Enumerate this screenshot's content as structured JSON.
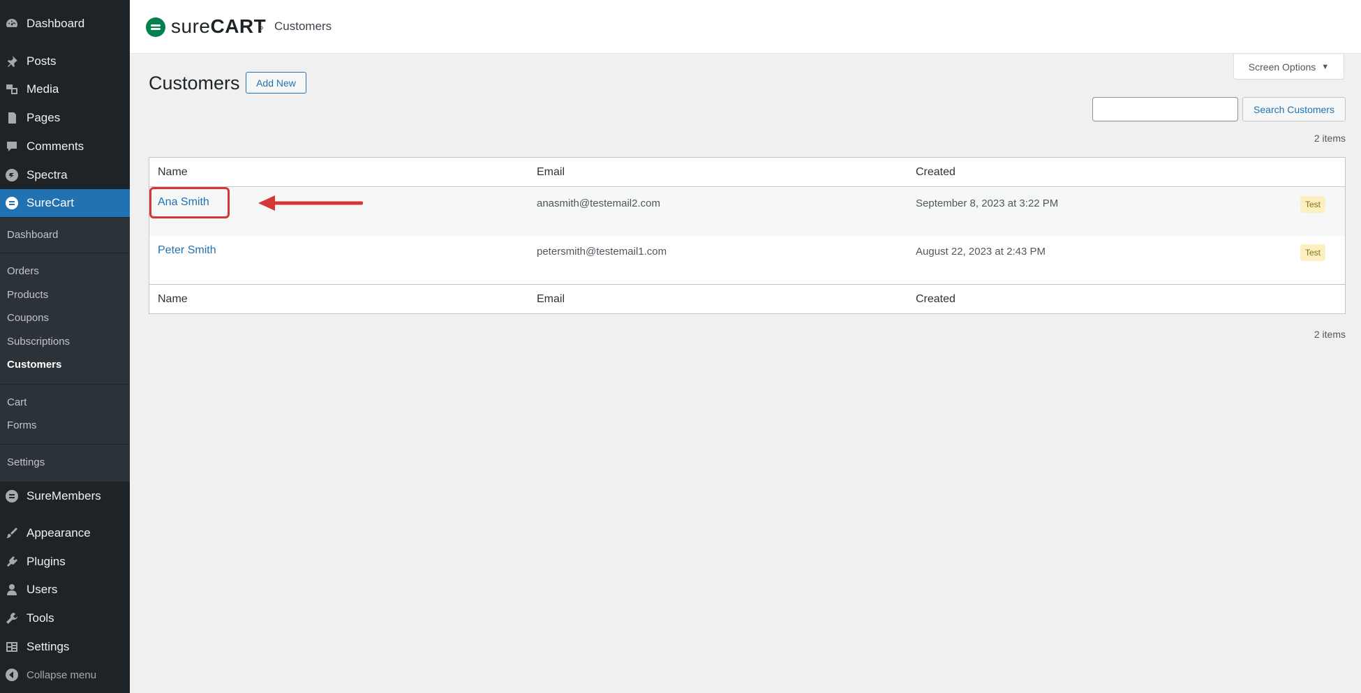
{
  "sidebar": {
    "top_items": [
      {
        "label": "Dashboard",
        "icon": "dashboard-icon"
      },
      {
        "label": "Posts",
        "icon": "pin-icon"
      },
      {
        "label": "Media",
        "icon": "media-icon"
      },
      {
        "label": "Pages",
        "icon": "pages-icon"
      },
      {
        "label": "Comments",
        "icon": "comment-icon"
      },
      {
        "label": "Spectra",
        "icon": "spectra-icon"
      },
      {
        "label": "SureCart",
        "icon": "surecart-icon"
      }
    ],
    "surecart_submenu": {
      "dashboard": "Dashboard",
      "orders": "Orders",
      "products": "Products",
      "coupons": "Coupons",
      "subscriptions": "Subscriptions",
      "customers": "Customers",
      "cart": "Cart",
      "forms": "Forms",
      "settings": "Settings"
    },
    "bottom_items": [
      {
        "label": "SureMembers",
        "icon": "suremembers-icon"
      },
      {
        "label": "Appearance",
        "icon": "brush-icon"
      },
      {
        "label": "Plugins",
        "icon": "plugin-icon"
      },
      {
        "label": "Users",
        "icon": "users-icon"
      },
      {
        "label": "Tools",
        "icon": "wrench-icon"
      },
      {
        "label": "Settings",
        "icon": "settings-icon"
      },
      {
        "label": "Collapse menu",
        "icon": "collapse-icon"
      }
    ]
  },
  "header": {
    "logo_sure": "sure",
    "logo_cart": "CART",
    "breadcrumb_separator": "›",
    "breadcrumb_current": "Customers"
  },
  "screen_options": {
    "label": "Screen Options",
    "arrow": "▼"
  },
  "page": {
    "title": "Customers",
    "add_new_label": "Add New",
    "search_placeholder": "",
    "search_button_label": "Search Customers",
    "items_count_top": "2 items",
    "items_count_bottom": "2 items"
  },
  "table": {
    "columns": [
      "Name",
      "Email",
      "Created"
    ],
    "rows": [
      {
        "name": "Ana Smith",
        "email": "anasmith@testemail2.com",
        "created": "September 8, 2023 at 3:22 PM",
        "badge": "Test"
      },
      {
        "name": "Peter Smith",
        "email": "petersmith@testemail1.com",
        "created": "August 22, 2023 at 2:43 PM",
        "badge": "Test"
      }
    ]
  },
  "colors": {
    "sidebar_bg": "#1d2327",
    "active_menu": "#2271b1",
    "link": "#2271b1",
    "highlight": "#d63638",
    "badge_bg": "#fcf0c3"
  }
}
